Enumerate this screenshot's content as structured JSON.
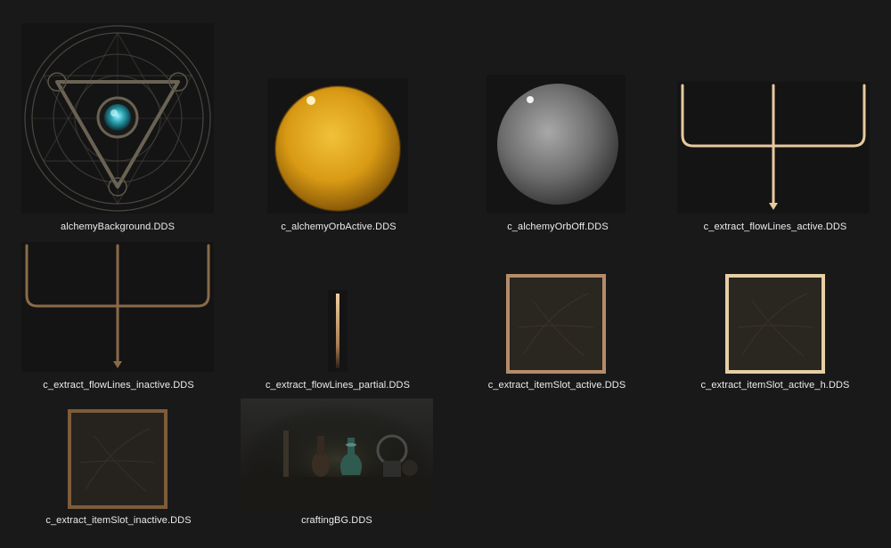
{
  "files": [
    {
      "name": "alchemyBackground.DDS",
      "icon": "magic-circle-thumbnail"
    },
    {
      "name": "c_alchemyOrbActive.DDS",
      "icon": "golden-orb-thumbnail"
    },
    {
      "name": "c_alchemyOrbOff.DDS",
      "icon": "grey-orb-thumbnail"
    },
    {
      "name": "c_extract_flowLines_active.DDS",
      "icon": "flow-lines-active-thumbnail"
    },
    {
      "name": "c_extract_flowLines_inactive.DDS",
      "icon": "flow-lines-inactive-thumbnail"
    },
    {
      "name": "c_extract_flowLines_partial.DDS",
      "icon": "flow-line-partial-thumbnail"
    },
    {
      "name": "c_extract_itemSlot_active.DDS",
      "icon": "item-slot-active-thumbnail"
    },
    {
      "name": "c_extract_itemSlot_active_h.DDS",
      "icon": "item-slot-active-h-thumbnail"
    },
    {
      "name": "c_extract_itemSlot_inactive.DDS",
      "icon": "item-slot-inactive-thumbnail"
    },
    {
      "name": "craftingBG.DDS",
      "icon": "crafting-background-thumbnail"
    }
  ],
  "colors": {
    "background": "#191919",
    "orb_gold": "#e0a420",
    "line_active": "#e8c9a0",
    "line_inactive": "#8a6a48"
  }
}
